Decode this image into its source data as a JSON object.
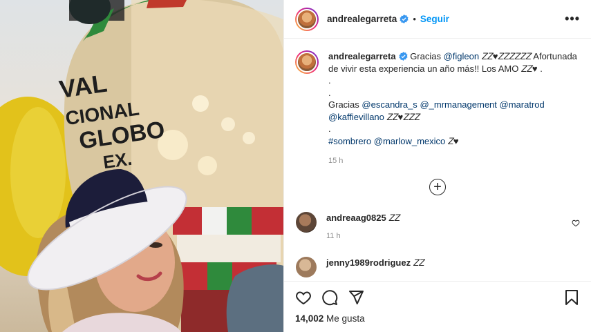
{
  "post": {
    "username": "andrealegarreta",
    "follow_label": "Seguir",
    "dot": "•",
    "more_label": "•••"
  },
  "caption": {
    "username": "andrealegarreta",
    "line1_prefix": "Gracias ",
    "mention_figleon": "@figleon",
    "line1_rest": " 𝑍𝑍♥𝑍𝑍𝑍𝑍𝑍𝑍 Afortunada de vivir esta experiencia un año más!! Los AMO 𝑍𝑍♥ .",
    "dot1": ".",
    "dot2": ".",
    "gracias2": "Gracias ",
    "mention_escandra": "@escandra_s",
    "mention_mrmanagement": "@_mrmanagement",
    "mention_maratrod": "@maratrod",
    "mention_kaffie": "@kaffievillano",
    "emojis2": "𝑍𝑍♥𝑍𝑍𝑍",
    "dot3": ".",
    "hashtag": "#sombrero",
    "mention_marlow": "@marlow_mexico",
    "end_emojis": " 𝑍♥",
    "time": "15 h"
  },
  "comments": [
    {
      "username": "andreaag0825",
      "text": "𝑍𝑍",
      "time": "11 h"
    },
    {
      "username": "jenny1989rodriguez",
      "text": "𝑍𝑍",
      "time": ""
    }
  ],
  "loadmore_label": "+",
  "likes": {
    "count": "14,002",
    "label": " Me gusta"
  },
  "photo": {
    "balloon_text": [
      "VAL",
      "CIONAL",
      "GLOBO",
      "EX."
    ]
  },
  "colors": {
    "accent": "#0095f6",
    "link": "#00376b",
    "muted": "#8e8e8e"
  }
}
